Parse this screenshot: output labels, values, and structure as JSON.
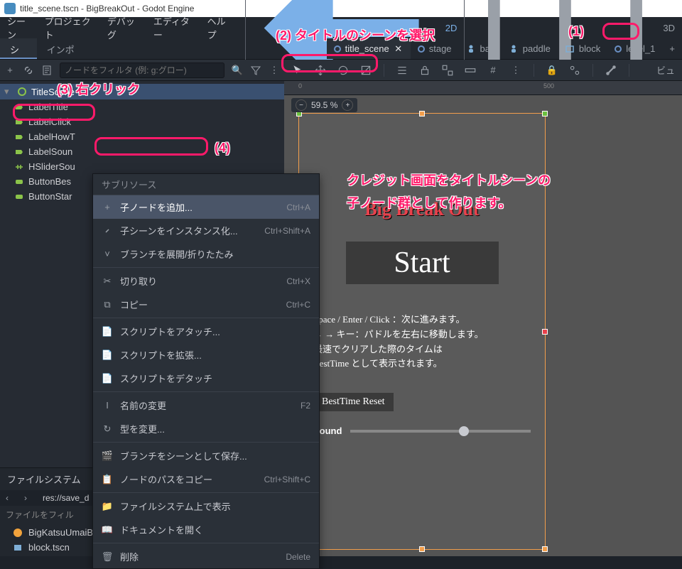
{
  "window_title": "title_scene.tscn - BigBreakOut - Godot Engine",
  "menubar": {
    "items": [
      "シーン",
      "プロジェクト",
      "デバッグ",
      "エディター",
      "ヘルプ"
    ],
    "btn2d": "2D",
    "btn3d": "3D"
  },
  "left_tabs": {
    "scene": "シーン",
    "import": "インポート"
  },
  "scene_tabs": [
    {
      "label": "title_scene",
      "active": true,
      "kind": "circle"
    },
    {
      "label": "stage",
      "active": false,
      "kind": "circle"
    },
    {
      "label": "ball",
      "active": false,
      "kind": "node"
    },
    {
      "label": "paddle",
      "active": false,
      "kind": "node"
    },
    {
      "label": "block",
      "active": false,
      "kind": "rect"
    },
    {
      "label": "level_1",
      "active": false,
      "kind": "circle"
    }
  ],
  "tree_toolbar": {
    "search_placeholder": "ノードをフィルタ (例: g:グロー)"
  },
  "scene_tree": {
    "root": "TitleScene",
    "children": [
      "LabelTitle",
      "LabelClick",
      "LabelHowT",
      "LabelSoun",
      "HSliderSou",
      "ButtonBes",
      "ButtonStar"
    ]
  },
  "context_menu": {
    "header": "サブリソース",
    "items": [
      {
        "label": "子ノードを追加...",
        "shortcut": "Ctrl+A",
        "highlighted": true
      },
      {
        "label": "子シーンをインスタンス化...",
        "shortcut": "Ctrl+Shift+A"
      },
      {
        "label": "ブランチを展開/折りたたみ",
        "shortcut": ""
      },
      {
        "sep": true
      },
      {
        "label": "切り取り",
        "shortcut": "Ctrl+X"
      },
      {
        "label": "コピー",
        "shortcut": "Ctrl+C"
      },
      {
        "sep": true
      },
      {
        "label": "スクリプトをアタッチ...",
        "shortcut": ""
      },
      {
        "label": "スクリプトを拡張...",
        "shortcut": ""
      },
      {
        "label": "スクリプトをデタッチ",
        "shortcut": ""
      },
      {
        "sep": true
      },
      {
        "label": "名前の変更",
        "shortcut": "F2"
      },
      {
        "label": "型を変更...",
        "shortcut": ""
      },
      {
        "sep": true
      },
      {
        "label": "ブランチをシーンとして保存...",
        "shortcut": ""
      },
      {
        "label": "ノードのパスをコピー",
        "shortcut": "Ctrl+Shift+C"
      },
      {
        "sep": true
      },
      {
        "label": "ファイルシステム上で表示",
        "shortcut": ""
      },
      {
        "label": "ドキュメントを開く",
        "shortcut": ""
      },
      {
        "sep": true
      },
      {
        "label": "削除",
        "shortcut": "Delete"
      }
    ]
  },
  "filesystem": {
    "title": "ファイルシステム",
    "path": "res://save_d",
    "filter": "ファイルをフィル",
    "items": [
      "BigKatsuUmaiBall.png",
      "block.tscn"
    ]
  },
  "viewport": {
    "zoom": "59.5 %",
    "ruler_marks": [
      0,
      500
    ],
    "game": {
      "title": "Big Break Out",
      "start": "Start",
      "howto": "Space / Enter / Click ：次に進みます。\n← → キー：パドルを左右に移動します。\n最速でクリアした際のタイムは\nBestTime として表示されます。",
      "besttime": "BestTime Reset",
      "sound": "Sound"
    }
  },
  "annotations": {
    "a1": "(1)",
    "a2": "(2) タイトルのシーンを選択",
    "a3": "(3) 右クリック",
    "a4": "(4)",
    "jp1": "クレジット画面をタイトルシーンの",
    "jp2": "子ノード群として作ります。"
  }
}
